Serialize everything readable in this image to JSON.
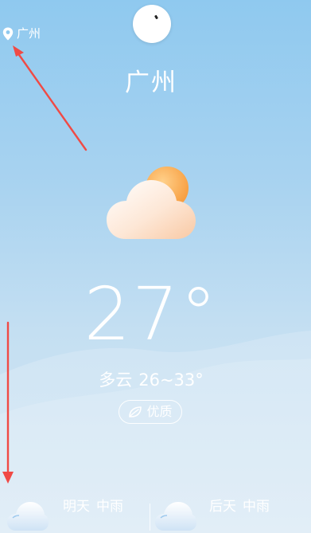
{
  "location": {
    "icon": "location-pin-icon",
    "label": "广州"
  },
  "city_title": "广州",
  "current": {
    "icon": "partly-cloudy-icon",
    "temperature": "27°",
    "condition": "多云",
    "range": "26~33°"
  },
  "air_quality": {
    "icon": "leaf-icon",
    "label": "优质"
  },
  "forecast": [
    {
      "day": "明天",
      "condition": "中雨",
      "icon": "rain-cloud-icon"
    },
    {
      "day": "后天",
      "condition": "中雨",
      "icon": "rain-cloud-icon"
    }
  ],
  "annotation_color": "#f04a45"
}
